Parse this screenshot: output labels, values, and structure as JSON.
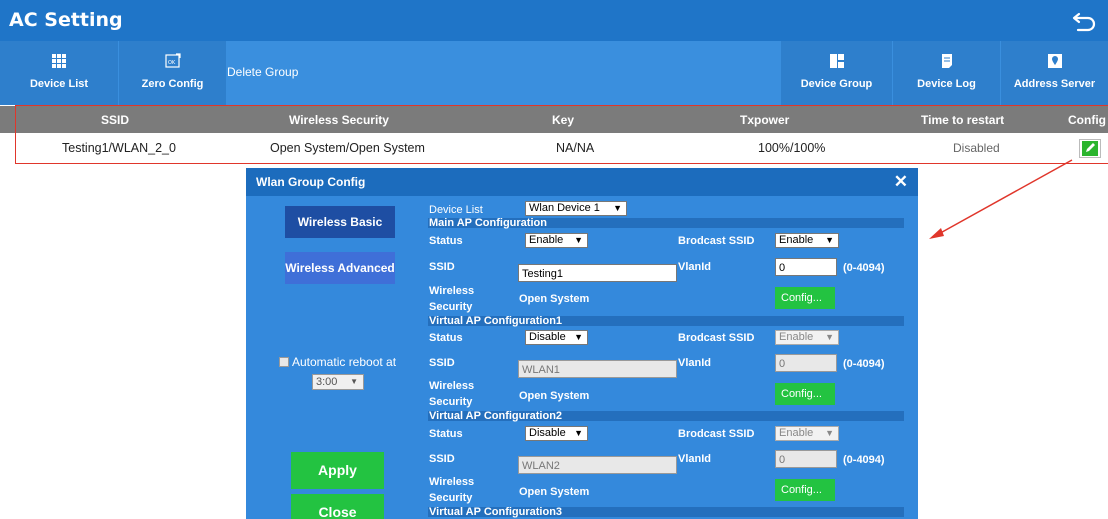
{
  "window": {
    "title": "AC Setting"
  },
  "toolbar": {
    "device_list": "Device List",
    "zero_config": "Zero Config",
    "delete_group": "Delete Group",
    "device_group": "Device Group",
    "device_log": "Device Log",
    "address_server": "Address Server"
  },
  "table": {
    "headers": {
      "ssid": "SSID",
      "security": "Wireless Security",
      "key": "Key",
      "txpower": "Txpower",
      "restart": "Time to restart",
      "config": "Config"
    },
    "row": {
      "ssid": "Testing1/WLAN_2_0",
      "security": "Open System/Open System",
      "key": "NA/NA",
      "txpower": "100%/100%",
      "restart": "Disabled"
    }
  },
  "dialog": {
    "title": "Wlan Group Config",
    "side": {
      "basic": "Wireless Basic",
      "advanced": "Wireless Advanced",
      "auto_reboot": "Automatic reboot at",
      "reboot_time": "3:00",
      "apply": "Apply",
      "close": "Close"
    },
    "device_list_label": "Device List",
    "device_list_value": "Wlan Device 1",
    "labels": {
      "status": "Status",
      "broadcast": "Brodcast SSID",
      "ssid": "SSID",
      "vlanid": "VlanId",
      "wireless": "Wireless",
      "security": "Security",
      "range": "(0-4094)",
      "config": "Config..."
    },
    "sections": [
      {
        "title": "Main AP Configuration",
        "status": "Enable",
        "broadcast": "Enable",
        "ssid": "Testing1",
        "vlan": "0",
        "security": "Open System"
      },
      {
        "title": "Virtual AP Configuration1",
        "status": "Disable",
        "broadcast": "Enable",
        "ssid": "WLAN1",
        "vlan": "0",
        "security": "Open System"
      },
      {
        "title": "Virtual AP Configuration2",
        "status": "Disable",
        "broadcast": "Enable",
        "ssid": "WLAN2",
        "vlan": "0",
        "security": "Open System"
      },
      {
        "title": "Virtual AP Configuration3"
      }
    ]
  },
  "colors": {
    "titlebar": "#1f75c8",
    "toolbar": "#3a8fde",
    "dialog": "#3489dc",
    "green": "#23c341",
    "red": "#e0362b"
  }
}
